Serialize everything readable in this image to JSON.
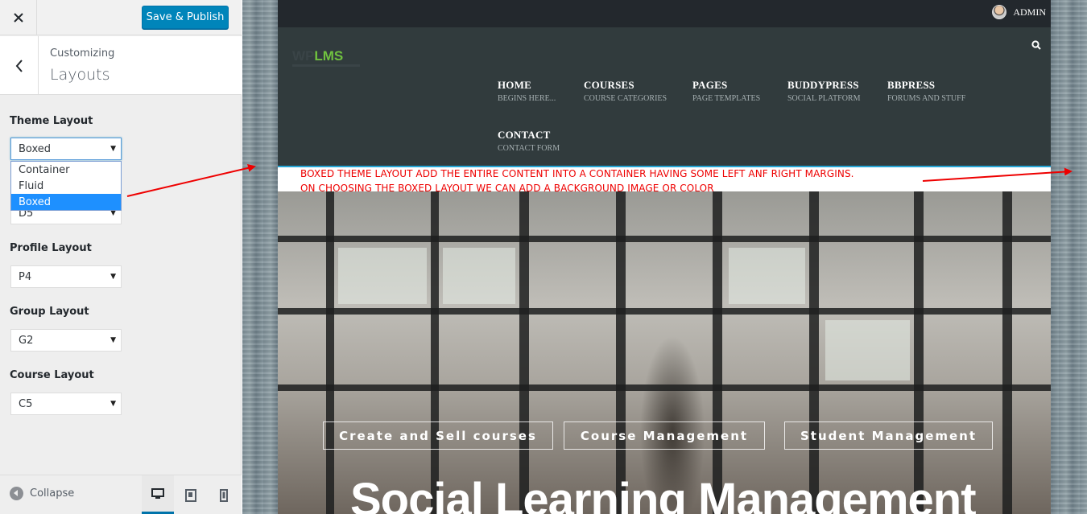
{
  "topbar": {
    "publish_label": "Save & Publish"
  },
  "section": {
    "breadcrumb": "Customizing",
    "title": "Layouts"
  },
  "controls": {
    "theme_layout": {
      "label": "Theme Layout",
      "value": "Boxed",
      "options": [
        "Container",
        "Fluid",
        "Boxed"
      ],
      "highlighted": "Boxed"
    },
    "directory_layout": {
      "value": "D5"
    },
    "profile_layout": {
      "label": "Profile Layout",
      "value": "P4"
    },
    "group_layout": {
      "label": "Group Layout",
      "value": "G2"
    },
    "course_layout": {
      "label": "Course Layout",
      "value": "C5"
    }
  },
  "footer": {
    "collapse_label": "Collapse",
    "devices": [
      "desktop-icon",
      "tablet-icon",
      "mobile-icon"
    ],
    "active_device": "desktop"
  },
  "preview": {
    "admin_name": "ADMIN",
    "logo": {
      "part1": "WP",
      "part2": "LMS"
    },
    "nav": [
      {
        "label": "HOME",
        "sub": "BEGINS HERE..."
      },
      {
        "label": "COURSES",
        "sub": "COURSE CATEGORIES"
      },
      {
        "label": "PAGES",
        "sub": "PAGE TEMPLATES"
      },
      {
        "label": "BUDDYPRESS",
        "sub": "SOCIAL PLATFORM"
      },
      {
        "label": "BBPRESS",
        "sub": "FORUMS AND STUFF"
      },
      {
        "label": "CONTACT",
        "sub": "CONTACT FORM"
      }
    ],
    "annotation": [
      "BOXED THEME LAYOUT ADD THE ENTIRE CONTENT INTO A CONTAINER HAVING SOME LEFT ANF RIGHT MARGINS.",
      "ON CHOOSING THE BOXED LAYOUT WE CAN ADD A BACKGROUND IMAGE OR COLOR"
    ],
    "hero_buttons": [
      "Create and Sell courses",
      "Course Management",
      "Student Management"
    ],
    "hero_title": "Social Learning Management"
  },
  "colors": {
    "primary": "#0085ba",
    "logo_green": "#70c23f",
    "header_bg": "#313b3d",
    "annotation": "#ee0000",
    "accent_line": "#26a6d6"
  }
}
